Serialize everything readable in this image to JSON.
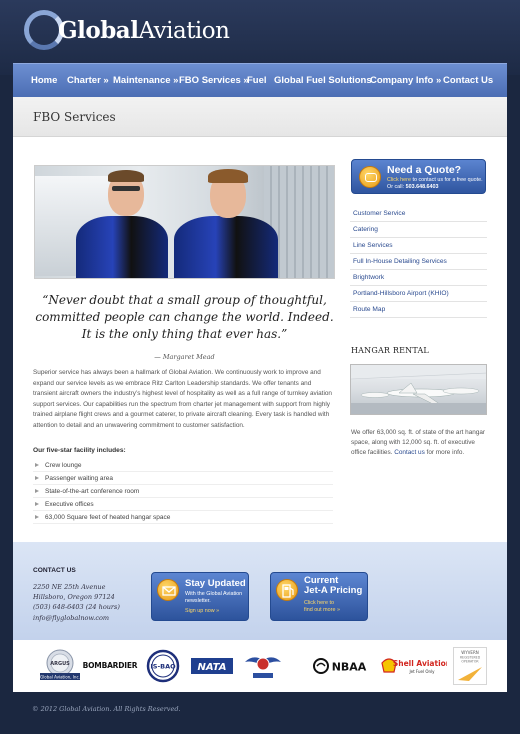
{
  "brand": {
    "name_part1": "Global",
    "name_part2": "Aviation"
  },
  "nav": {
    "items": [
      {
        "label": "Home"
      },
      {
        "label": "Charter »"
      },
      {
        "label": "Maintenance »"
      },
      {
        "label": "FBO Services »"
      },
      {
        "label": "Fuel"
      },
      {
        "label": "Global Fuel Solutions"
      },
      {
        "label": "Company Info »"
      },
      {
        "label": "Contact Us"
      }
    ]
  },
  "page": {
    "title": "FBO Services"
  },
  "main": {
    "quote": "“Never doubt that a small group of thoughtful, committed people can change the world. Indeed. It is the only thing that ever has.”",
    "quote_author": "— Margaret Mead",
    "body": "Superior service has always been a hallmark of Global Aviation.  We continuously work to improve and expand our service levels as we embrace Ritz Carlton Leadership standards.  We offer tenants and transient aircraft owners the industry’s highest level of hospitality as well as a full range of turnkey aviation support services.  Our capabilities run the spectrum from charter jet management with support from highly trained airplane flight crews and a gourmet caterer, to private aircraft cleaning. Every task is handled with attention to detail and an unwavering commitment to customer satisfaction.",
    "facility_heading": "Our five-star facility includes:",
    "facilities": [
      {
        "label": "Crew lounge"
      },
      {
        "label": "Passenger waiting area"
      },
      {
        "label": "State-of-the-art conference room"
      },
      {
        "label": "Executive offices"
      },
      {
        "label": "63,000 Square feet of heated hangar space"
      }
    ]
  },
  "sidebar": {
    "quote_box": {
      "title": "Need a Quote?",
      "link_text": "Click here",
      "text_mid": " to contact us for a free quote. Or call: ",
      "phone": "503.648.6403"
    },
    "links": [
      {
        "label": "Customer Service"
      },
      {
        "label": "Catering"
      },
      {
        "label": "Line Services"
      },
      {
        "label": "Full In-House Detailing Services"
      },
      {
        "label": "Brightwork"
      },
      {
        "label": "Portland-Hillsboro Airport (KHIO)"
      },
      {
        "label": "Route Map"
      }
    ],
    "hangar": {
      "title": "HANGAR RENTAL",
      "text": "We offer 63,000 sq. ft. of state of the art hangar space, along with 12,000 sq. ft. of executive office facilities. ",
      "link_text": "Contact us",
      "text_end": " for more info."
    }
  },
  "footer": {
    "contact_title": "CONTACT US",
    "address1": "2250 NE 25th Avenue",
    "address2": "Hillsboro, Oregon 97124",
    "phone": "(503) 648-6403 (24 hours)",
    "email": "info@flyglobalnow.com",
    "promo_stay": {
      "title": "Stay Updated",
      "sub": "With the Global Aviation newsletter.",
      "link": "Sign up now »"
    },
    "promo_fuel": {
      "title_line1": "Current",
      "title_line2": "Jet-A Pricing",
      "link1": "Click here to",
      "link2": "find out more »"
    },
    "logos": {
      "argus": "ARGUS",
      "argus_sub": "Global Aviation, Inc.",
      "bombardier": "BOMBARDIER",
      "isbao": "IS-BAO",
      "nata": "NATA",
      "nbaa": "NBAA",
      "shell": "Shell Aviation",
      "shell_sub": "Jet Fuel Only",
      "wyvern": "WYVERN",
      "wyvern_sub1": "REGISTERED",
      "wyvern_sub2": "OPERATOR"
    },
    "copyright": "© 2012 Global Aviation. All Rights Reserved."
  },
  "colors": {
    "nav_blue": "#5577bd",
    "link_blue": "#2a4a8f",
    "accent_yellow": "#ffd966",
    "dark_bg": "#1b2740"
  }
}
